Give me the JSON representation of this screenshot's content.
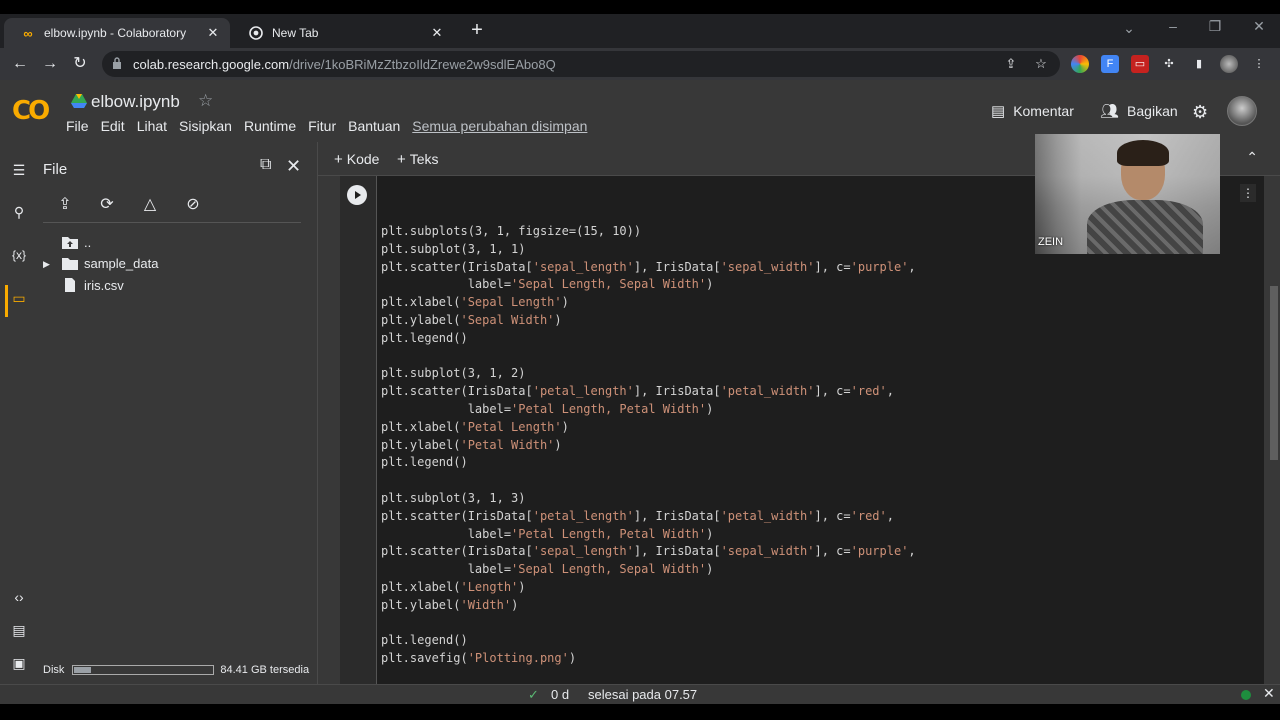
{
  "browser": {
    "tabs": [
      {
        "title": "elbow.ipynb - Colaboratory",
        "favicon": "colab-icon"
      },
      {
        "title": "New Tab",
        "favicon": "chrome-icon"
      }
    ],
    "url_host": "colab.research.google.com",
    "url_path": "/drive/1koBRiMzZtbzoIldZrewe2w9sdlEAbo8Q"
  },
  "colab": {
    "logo": "CO",
    "notebook_title": "elbow.ipynb",
    "menu": [
      "File",
      "Edit",
      "Lihat",
      "Sisipkan",
      "Runtime",
      "Fitur",
      "Bantuan"
    ],
    "saved_status": "Semua perubahan disimpan",
    "comment_label": "Komentar",
    "share_label": "Bagikan"
  },
  "file_panel": {
    "title": "File",
    "tree": [
      {
        "name": ".."
      },
      {
        "name": "sample_data"
      },
      {
        "name": "iris.csv"
      }
    ],
    "disk_label": "Disk",
    "disk_fill": 0.12,
    "disk_free": "84.41 GB tersedia"
  },
  "toolbar": {
    "add_code": "Kode",
    "add_text": "Teks"
  },
  "code_lines": [
    "plt.subplots(3, 1, figsize=(15, 10))",
    "plt.subplot(3, 1, 1)",
    "plt.scatter(IrisData['sepal_length'], IrisData['sepal_width'], c='purple',",
    "            label='Sepal Length, Sepal Width')",
    "plt.xlabel('Sepal Length')",
    "plt.ylabel('Sepal Width')",
    "plt.legend()",
    "",
    "plt.subplot(3, 1, 2)",
    "plt.scatter(IrisData['petal_length'], IrisData['petal_width'], c='red',",
    "            label='Petal Length, Petal Width')",
    "plt.xlabel('Petal Length')",
    "plt.ylabel('Petal Width')",
    "plt.legend()",
    "",
    "plt.subplot(3, 1, 3)",
    "plt.scatter(IrisData['petal_length'], IrisData['petal_width'], c='red',",
    "            label='Petal Length, Petal Width')",
    "plt.scatter(IrisData['sepal_length'], IrisData['sepal_width'], c='purple',",
    "            label='Sepal Length, Sepal Width')",
    "plt.xlabel('Length')",
    "plt.ylabel('Width')",
    "",
    "plt.legend()",
    "plt.savefig('Plotting.png')"
  ],
  "status": {
    "duration": "0 d",
    "completed": "selesai pada 07.57"
  },
  "webcam": {
    "name": "ZEIN"
  },
  "colors": {
    "accent": "#f9ab00",
    "string": "#ce9178",
    "ok": "#1e8e3e"
  }
}
